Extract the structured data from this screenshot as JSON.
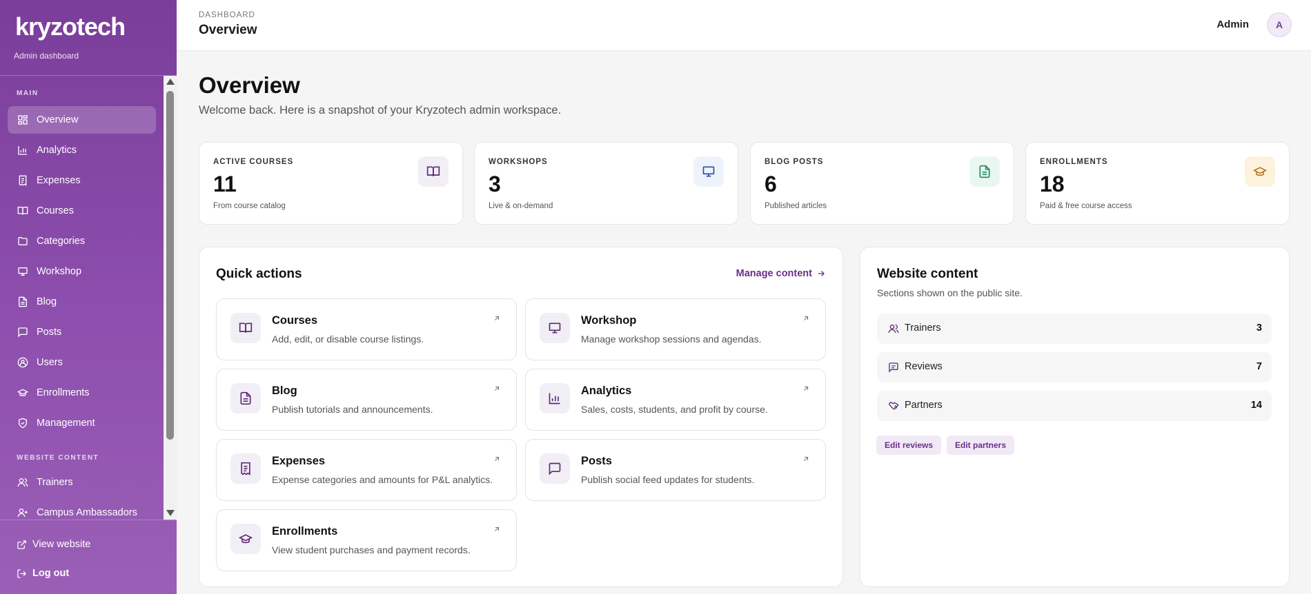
{
  "app": {
    "brand": "kryzotech",
    "subtitle": "Admin dashboard"
  },
  "sidebar": {
    "main_label": "MAIN",
    "main_items": [
      {
        "label": "Overview",
        "icon": "grid-icon",
        "active": true
      },
      {
        "label": "Analytics",
        "icon": "bar-chart-icon"
      },
      {
        "label": "Expenses",
        "icon": "receipt-icon"
      },
      {
        "label": "Courses",
        "icon": "book-icon"
      },
      {
        "label": "Categories",
        "icon": "folder-icon"
      },
      {
        "label": "Workshop",
        "icon": "presentation-icon"
      },
      {
        "label": "Blog",
        "icon": "file-text-icon"
      },
      {
        "label": "Posts",
        "icon": "message-square-icon"
      },
      {
        "label": "Users",
        "icon": "user-circle-icon"
      },
      {
        "label": "Enrollments",
        "icon": "graduation-cap-icon"
      },
      {
        "label": "Management",
        "icon": "shield-check-icon"
      }
    ],
    "website_label": "WEBSITE CONTENT",
    "website_items": [
      {
        "label": "Trainers",
        "icon": "users-icon"
      },
      {
        "label": "Campus Ambassadors",
        "icon": "user-plus-icon"
      }
    ],
    "view_website": "View website",
    "logout": "Log out"
  },
  "topbar": {
    "breadcrumb": "DASHBOARD",
    "title": "Overview",
    "user": "Admin",
    "avatar": "A"
  },
  "main": {
    "title": "Overview",
    "subtitle": "Welcome back. Here is a snapshot of your Kryzotech admin workspace."
  },
  "stats": [
    {
      "label": "ACTIVE COURSES",
      "value": "11",
      "sub": "From course catalog",
      "icon": "book-icon",
      "bg": "#f2eef5",
      "color": "#5b2a75"
    },
    {
      "label": "WORKSHOPS",
      "value": "3",
      "sub": "Live & on-demand",
      "icon": "presentation-icon",
      "bg": "#eef3fb",
      "color": "#1f4fa8"
    },
    {
      "label": "BLOG POSTS",
      "value": "6",
      "sub": "Published articles",
      "icon": "file-text-icon",
      "bg": "#e9f7f0",
      "color": "#1f8a5b"
    },
    {
      "label": "ENROLLMENTS",
      "value": "18",
      "sub": "Paid & free course access",
      "icon": "graduation-cap-icon",
      "bg": "#fdf2dd",
      "color": "#b7791f"
    }
  ],
  "quick_actions": {
    "title": "Quick actions",
    "manage_link": "Manage content",
    "items": [
      {
        "title": "Courses",
        "desc": "Add, edit, or disable course listings.",
        "icon": "book-icon"
      },
      {
        "title": "Workshop",
        "desc": "Manage workshop sessions and agendas.",
        "icon": "presentation-icon"
      },
      {
        "title": "Blog",
        "desc": "Publish tutorials and announcements.",
        "icon": "file-text-icon"
      },
      {
        "title": "Analytics",
        "desc": "Sales, costs, students, and profit by course.",
        "icon": "bar-chart-icon"
      },
      {
        "title": "Expenses",
        "desc": "Expense categories and amounts for P&L analytics.",
        "icon": "receipt-icon"
      },
      {
        "title": "Posts",
        "desc": "Publish social feed updates for students.",
        "icon": "message-square-icon"
      },
      {
        "title": "Enrollments",
        "desc": "View student purchases and payment records.",
        "icon": "graduation-cap-icon"
      }
    ]
  },
  "website_content": {
    "title": "Website content",
    "subtitle": "Sections shown on the public site.",
    "rows": [
      {
        "label": "Trainers",
        "count": "3",
        "icon": "users-icon"
      },
      {
        "label": "Reviews",
        "count": "7",
        "icon": "message-square-icon"
      },
      {
        "label": "Partners",
        "count": "14",
        "icon": "handshake-icon"
      }
    ],
    "buttons": [
      "Edit reviews",
      "Edit partners"
    ]
  },
  "colors": {
    "sidebar": "#8a4aa8",
    "accent": "#6b2f8a"
  }
}
